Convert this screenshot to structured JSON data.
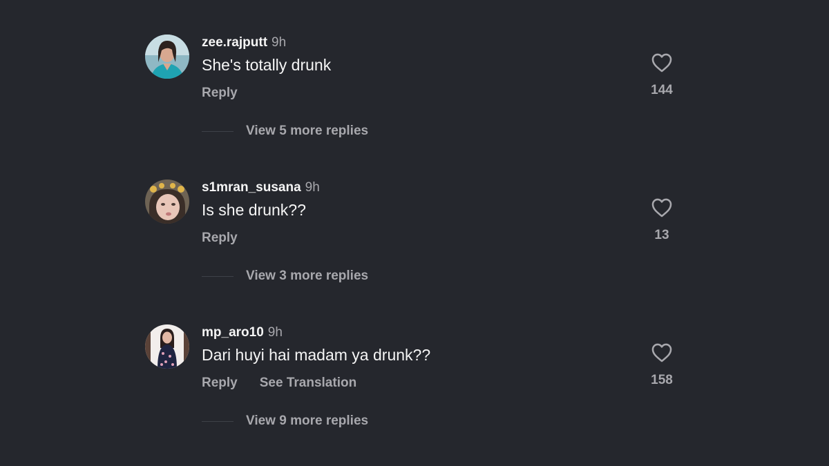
{
  "colors": {
    "background": "#25272d",
    "primary_text": "#f5f5f5",
    "secondary_text": "#a8a8ad"
  },
  "comments": [
    {
      "username": "zee.rajputt",
      "time": "9h",
      "text": "She's totally drunk",
      "reply_label": "Reply",
      "see_translation_label": "",
      "like_icon": "heart-outline-icon",
      "like_count": "144",
      "view_replies_label": "View 5 more replies"
    },
    {
      "username": "s1mran_susana",
      "time": "9h",
      "text": "Is she drunk??",
      "reply_label": "Reply",
      "see_translation_label": "",
      "like_icon": "heart-outline-icon",
      "like_count": "13",
      "view_replies_label": "View 3 more replies"
    },
    {
      "username": "mp_aro10",
      "time": "9h",
      "text": "Dari huyi hai madam ya drunk??",
      "reply_label": "Reply",
      "see_translation_label": "See Translation",
      "like_icon": "heart-outline-icon",
      "like_count": "158",
      "view_replies_label": "View 9 more replies"
    }
  ]
}
